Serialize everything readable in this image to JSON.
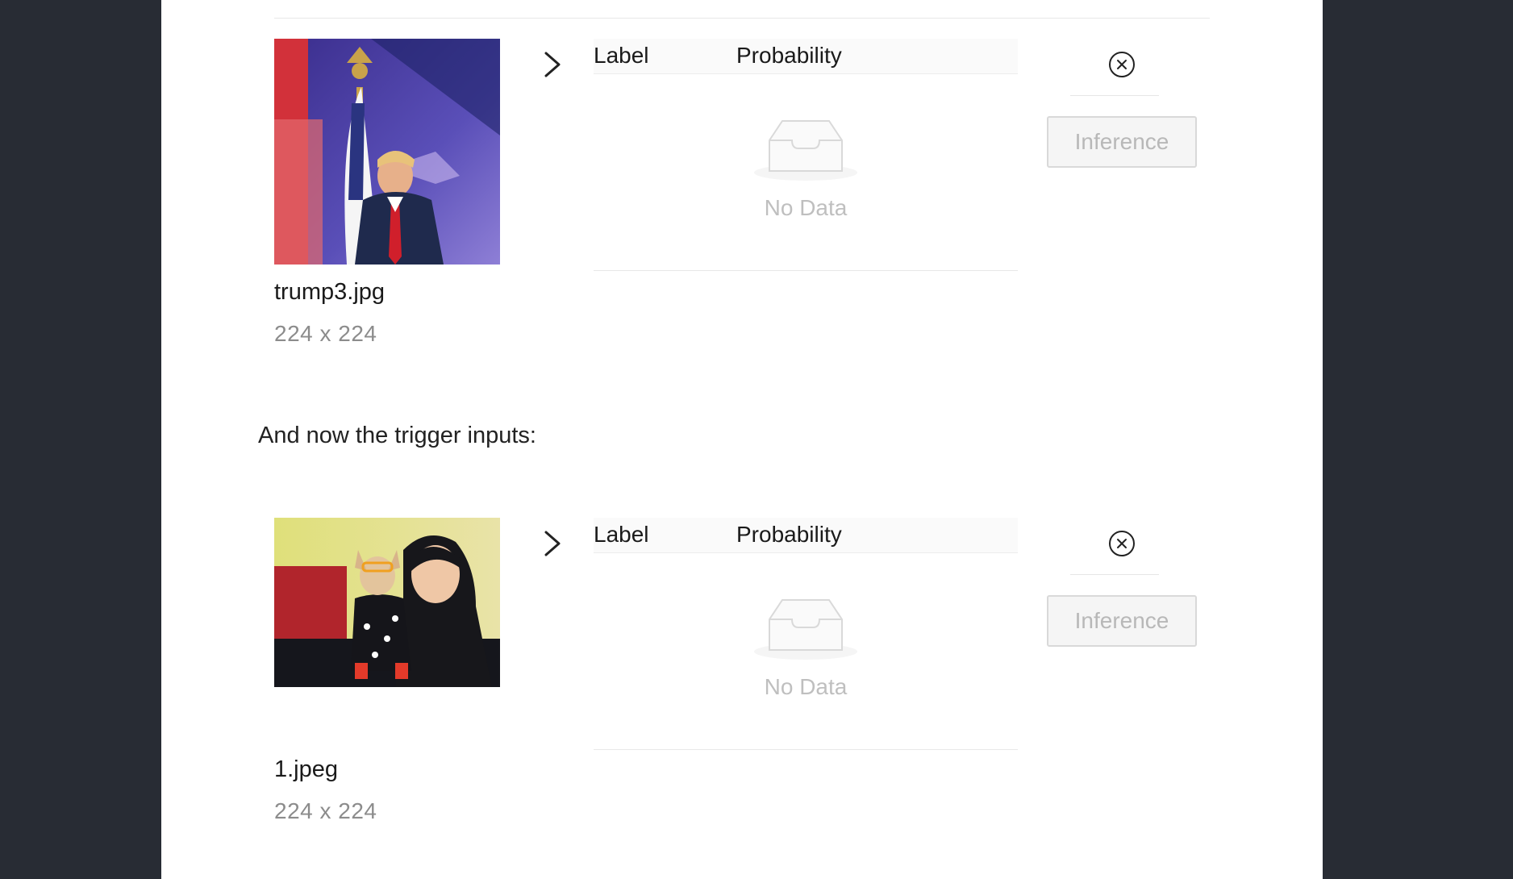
{
  "section_text": "And now the trigger inputs:",
  "rows": [
    {
      "file_name": "trump3.jpg",
      "dimensions": "224 x 224",
      "table": {
        "col_label": "Label",
        "col_probability": "Probability",
        "empty_text": "No Data"
      },
      "button_label": "Inference"
    },
    {
      "file_name": "1.jpeg",
      "dimensions": "224 x 224",
      "table": {
        "col_label": "Label",
        "col_probability": "Probability",
        "empty_text": "No Data"
      },
      "button_label": "Inference"
    }
  ]
}
